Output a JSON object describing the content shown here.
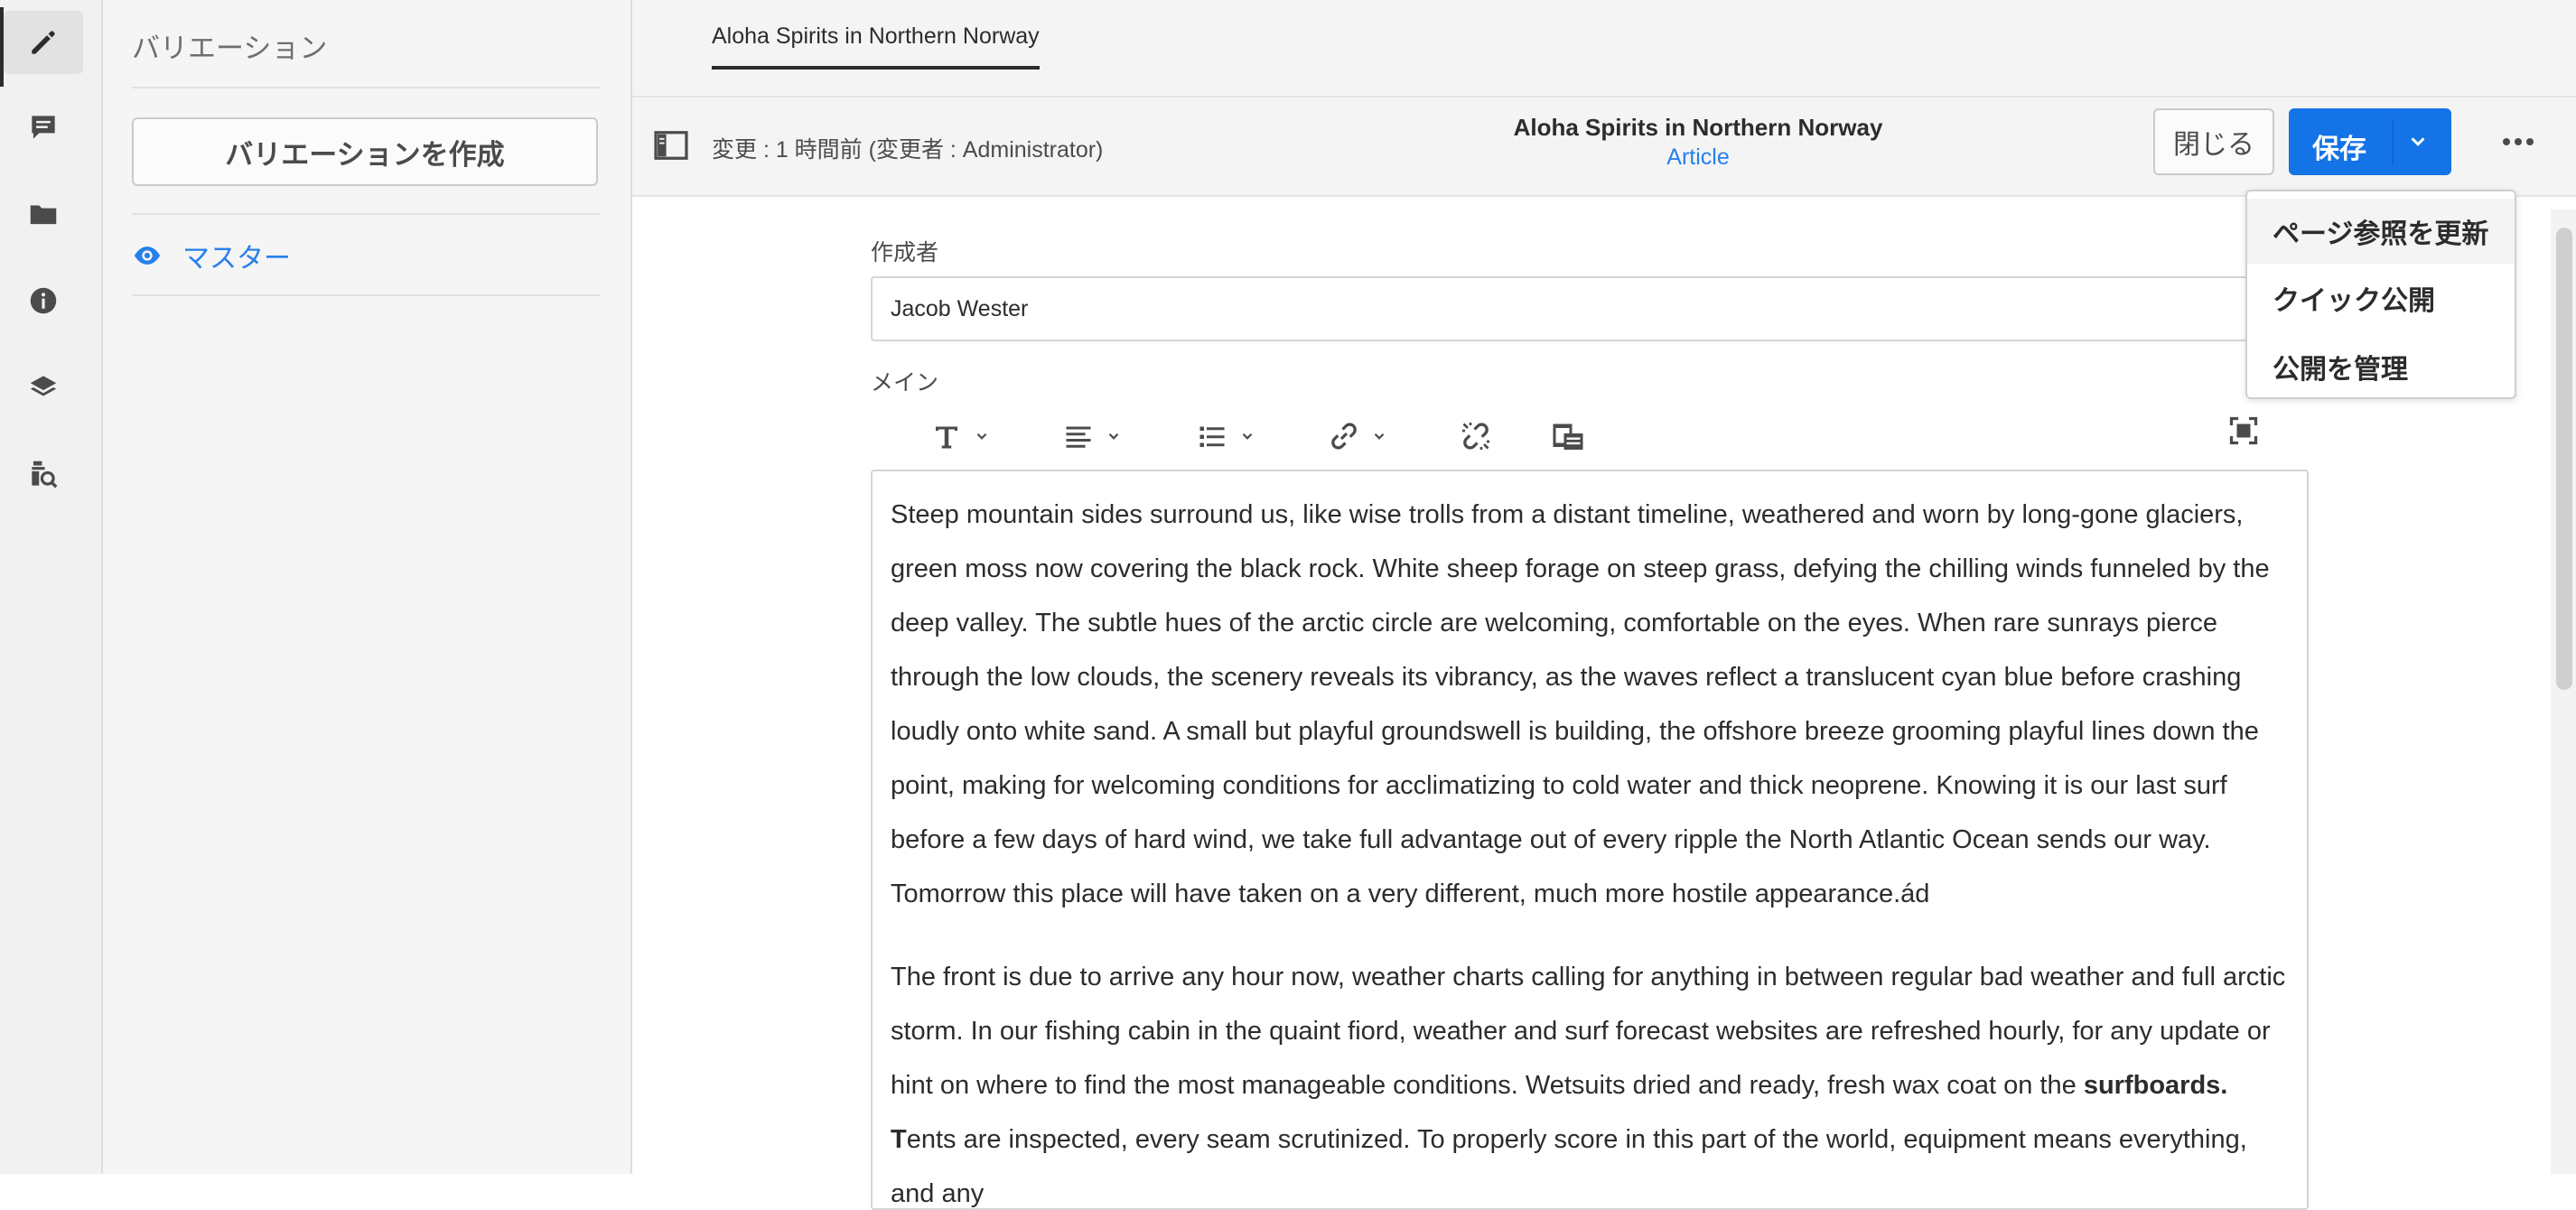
{
  "sidebar": {
    "rail": [
      {
        "icon": "edit-icon",
        "label": "",
        "active": true
      },
      {
        "icon": "annotations-icon",
        "label": ""
      },
      {
        "icon": "folder-icon",
        "label": ""
      },
      {
        "icon": "info-icon",
        "label": ""
      },
      {
        "icon": "layers-icon",
        "label": ""
      },
      {
        "icon": "asset-search-icon",
        "label": ""
      }
    ]
  },
  "variations": {
    "title": "バリエーション",
    "create_button": "バリエーションを作成",
    "items": [
      {
        "label": "マスター",
        "icon": "eye-icon",
        "selected": true
      }
    ]
  },
  "tabs": [
    {
      "label": "Aloha Spirits in Northern Norway",
      "active": true
    }
  ],
  "header": {
    "modified": "変更 : 1 時間前 (変更者 : Administrator)",
    "title": "Aloha Spirits in Northern Norway",
    "model": "Article",
    "close_label": "閉じる",
    "save_label": "保存"
  },
  "menu": {
    "items": [
      {
        "label": "ページ参照を更新"
      },
      {
        "label": "クイック公開"
      },
      {
        "label": "公開を管理"
      }
    ]
  },
  "form": {
    "author_label": "作成者",
    "author_value": "Jacob Wester",
    "main_label": "メイン",
    "toolbar": [
      {
        "icon": "text-format-icon",
        "dropdown": true
      },
      {
        "icon": "align-icon",
        "dropdown": true
      },
      {
        "icon": "list-icon",
        "dropdown": true
      },
      {
        "icon": "link-icon",
        "dropdown": true
      },
      {
        "icon": "unlink-icon",
        "dropdown": false
      },
      {
        "icon": "paste-as-text-icon",
        "dropdown": false
      },
      {
        "icon": "fullscreen-icon",
        "dropdown": false
      }
    ],
    "paragraphs": [
      {
        "text": "Steep mountain sides surround us, like wise trolls from a distant timeline, weathered and worn by long-gone glaciers, green moss now covering the black rock. White sheep forage on steep grass, defying the chilling winds funneled by the deep valley. The subtle hues of the arctic circle are welcoming, comfortable on the eyes. When rare sunrays pierce through the low clouds, the scenery reveals its vibrancy, as the waves reflect a translucent cyan blue before crashing loudly onto white sand. A small but playful groundswell is building, the offshore breeze grooming playful lines down the point, making for welcoming conditions for acclimatizing to cold water and thick neoprene. Knowing it is our last surf before a few days of hard wind, we take full advantage out of every ripple the North Atlantic Ocean sends our way. Tomorrow this place will have taken on a very different, much more hostile appearance.ád"
      },
      {
        "before": "The front is due to arrive any hour now, weather charts calling for anything in between regular bad weather and full arctic storm. In our fishing cabin in the quaint fiord, weather and surf forecast websites are refreshed hourly, for any update or hint on where to find the most manageable conditions. Wetsuits dried and ready, fresh wax coat on the ",
        "bold": "surfboards. T",
        "after": "ents are inspected, every seam scrutinized. To properly score in this part of the world, equipment means everything, and any"
      }
    ]
  },
  "colors": {
    "accent": "#2680eb",
    "primary_button": "#1473e6",
    "rail_bg": "#f1f1f1",
    "panel_bg": "#f5f5f5"
  }
}
